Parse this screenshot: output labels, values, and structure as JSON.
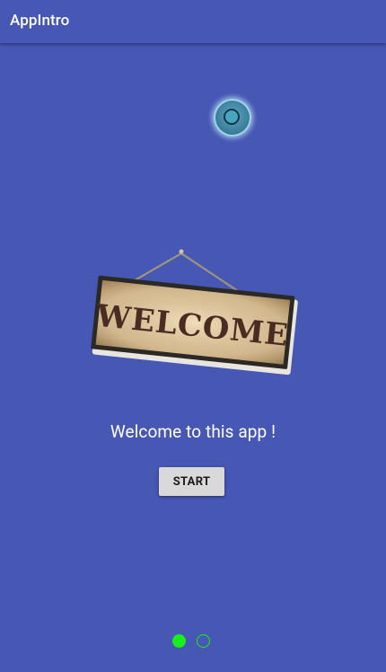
{
  "app_bar": {
    "title": "AppIntro"
  },
  "slide": {
    "image_text": "WELCOME",
    "description": "Welcome to this app !",
    "start_label": "START"
  },
  "pager": {
    "current_page": 1,
    "total_pages": 2
  },
  "colors": {
    "background": "#4657b4",
    "indicator_active": "#17f01a",
    "button_background": "#d9d9d9"
  },
  "icons": {
    "floating": "circle-target-icon",
    "sign": "welcome-sign-image"
  }
}
